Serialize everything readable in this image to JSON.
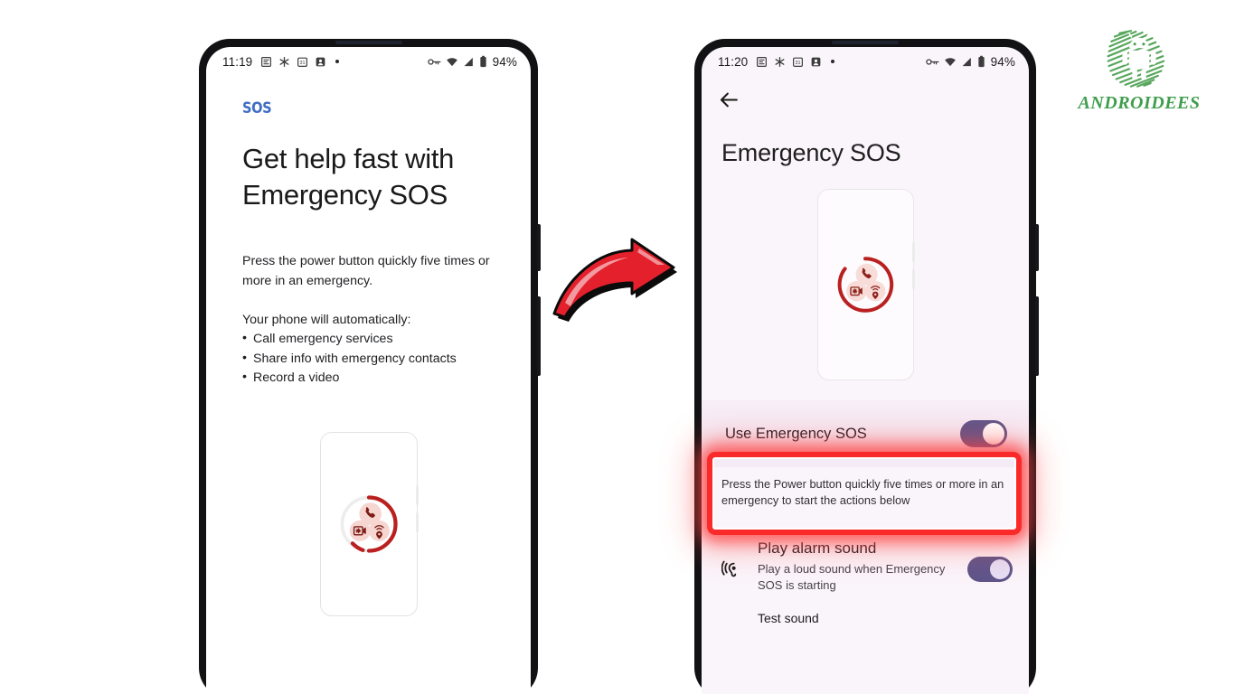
{
  "meta": {
    "accent_red": "#fb2a2a",
    "switch_purple": "#5e558a",
    "brand_green": "#3f9e4d",
    "sos_blue": "#3f6ec4"
  },
  "brand": {
    "name": "ANDROIDEES",
    "logo_icon": "android-robot-icon"
  },
  "arrow": {
    "icon": "red-curved-right-arrow-icon"
  },
  "left_phone": {
    "status_bar": {
      "time": "11:19",
      "battery_percent": "94%",
      "left_icons": [
        "list-icon",
        "snowflake-icon",
        "calendar-31-icon",
        "contact-card-icon",
        "dot-icon"
      ],
      "right_icons": [
        "vpn-key-icon",
        "wifi-icon",
        "signal-icon",
        "battery-icon"
      ]
    },
    "app_logo": "SOS",
    "title": "Get help fast with Emergency SOS",
    "paragraph": "Press the power button quickly five times or more in an emergency.",
    "list_intro": "Your phone will automatically:",
    "bullets": [
      "Call emergency services",
      "Share info with emergency contacts",
      "Record a video"
    ],
    "illustration": {
      "name": "emergency-sos-illustration",
      "icons": [
        "phone-call-icon",
        "emergency-video-icon",
        "location-broadcast-icon"
      ]
    }
  },
  "right_phone": {
    "status_bar": {
      "time": "11:20",
      "battery_percent": "94%",
      "left_icons": [
        "list-icon",
        "snowflake-icon",
        "calendar-31-icon",
        "contact-card-icon",
        "dot-icon"
      ],
      "right_icons": [
        "vpn-key-icon",
        "wifi-icon",
        "signal-icon",
        "battery-icon"
      ]
    },
    "back_button": "back-arrow-icon",
    "heading": "Emergency SOS",
    "illustration": {
      "name": "emergency-sos-illustration",
      "icons": [
        "phone-call-icon",
        "emergency-video-icon",
        "location-broadcast-icon"
      ]
    },
    "main_toggle": {
      "label": "Use Emergency SOS",
      "state": "on"
    },
    "helper_text": "Press the Power button quickly five times or more in an emergency to start the actions below",
    "settings": [
      {
        "icon": "hearing-sound-icon",
        "title": "Play alarm sound",
        "subtitle": "Play a loud sound when Emergency SOS is starting",
        "action_label": "Test sound",
        "state": "on"
      }
    ]
  }
}
